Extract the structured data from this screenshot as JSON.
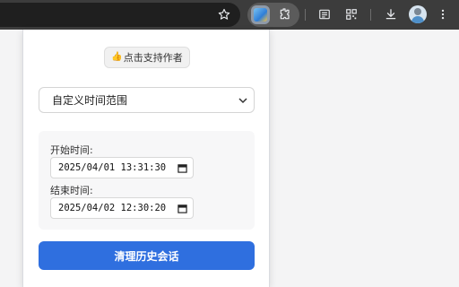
{
  "browser": {
    "icons": [
      "star-icon",
      "extension-app-icon",
      "puzzle-icon",
      "reading-list-icon",
      "qr-code-icon",
      "download-icon",
      "avatar",
      "menu-icon"
    ],
    "colors": {
      "toolbar": "#3c3c3c",
      "omnibox": "#1f1f1f",
      "icon": "#e8eaed"
    }
  },
  "popup": {
    "support_button": {
      "icon": "👍",
      "label": "点击支持作者"
    },
    "range_select": {
      "selected": "自定义时间范围"
    },
    "start": {
      "label": "开始时间:",
      "value": "2025/04/01 13:31:30"
    },
    "end": {
      "label": "结束时间:",
      "value": "2025/04/02 12:30:20"
    },
    "clean_button": {
      "label": "清理历史会话"
    },
    "colors": {
      "primary": "#2f6fdf",
      "card": "#f7f7f8"
    }
  }
}
